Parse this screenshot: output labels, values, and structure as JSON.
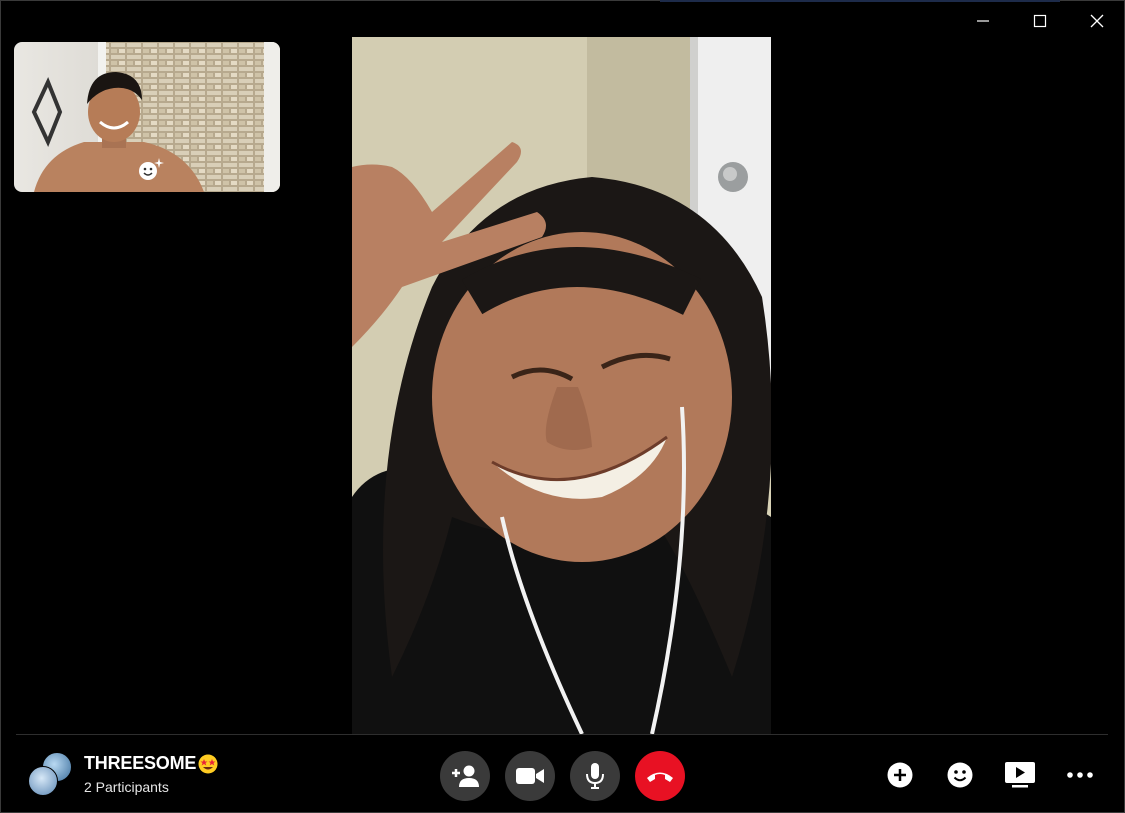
{
  "window": {
    "controls": [
      "minimize-icon",
      "maximize-icon",
      "close-icon"
    ]
  },
  "self_view": {
    "effects_icon": "effects-smiley-icon"
  },
  "call": {
    "title": "THREESOME",
    "title_emoji": "star-struck-emoji",
    "participants": "2 Participants"
  },
  "controls": {
    "center": [
      "add-participant-icon",
      "video-camera-icon",
      "microphone-icon",
      "end-call-icon"
    ],
    "right": [
      "add-icon",
      "emoji-icon",
      "share-screen-icon",
      "more-icon"
    ]
  },
  "colors": {
    "background": "#000000",
    "control_bg": "#3a3a3a",
    "end_call": "#e81123"
  }
}
